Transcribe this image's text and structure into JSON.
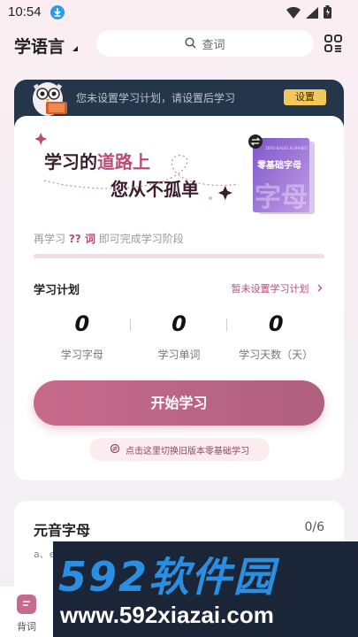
{
  "status_bar": {
    "time": "10:54"
  },
  "header": {
    "language": "学语言",
    "search_placeholder": "查词"
  },
  "banner": {
    "message": "您未设置学习计划，请设置后学习",
    "button": "设置"
  },
  "hero": {
    "slogan_a": "学习的",
    "slogan_highlight": "道路上",
    "slogan_b": "您从不孤单",
    "book_label": "零基础字母",
    "book_sub": "ZERO-BASED ALPHABET",
    "book_big": "字母"
  },
  "progress": {
    "prefix": "再学习",
    "count": "?? 词",
    "suffix": "即可完成学习阶段",
    "fraction": 0
  },
  "plan": {
    "title": "学习计划",
    "link": "暂未设置学习计划",
    "stats": [
      {
        "value": "0",
        "label": "学习字母"
      },
      {
        "value": "0",
        "label": "学习单词"
      },
      {
        "value": "0",
        "label": "学习天数（天）"
      }
    ]
  },
  "start_button": "开始学习",
  "switch_text": "点击这里切换旧版本零基础学习",
  "vowels": {
    "title": "元音字母",
    "count": "0/6",
    "letters": "a、e"
  },
  "tabbar": {
    "items": [
      {
        "label": "背词"
      }
    ]
  },
  "watermark": {
    "title": "592软件园",
    "url": "www.592xiazai.com"
  },
  "colors": {
    "accent": "#b84c74",
    "banner_bg": "#26364a",
    "banner_btn": "#f3c85a"
  }
}
